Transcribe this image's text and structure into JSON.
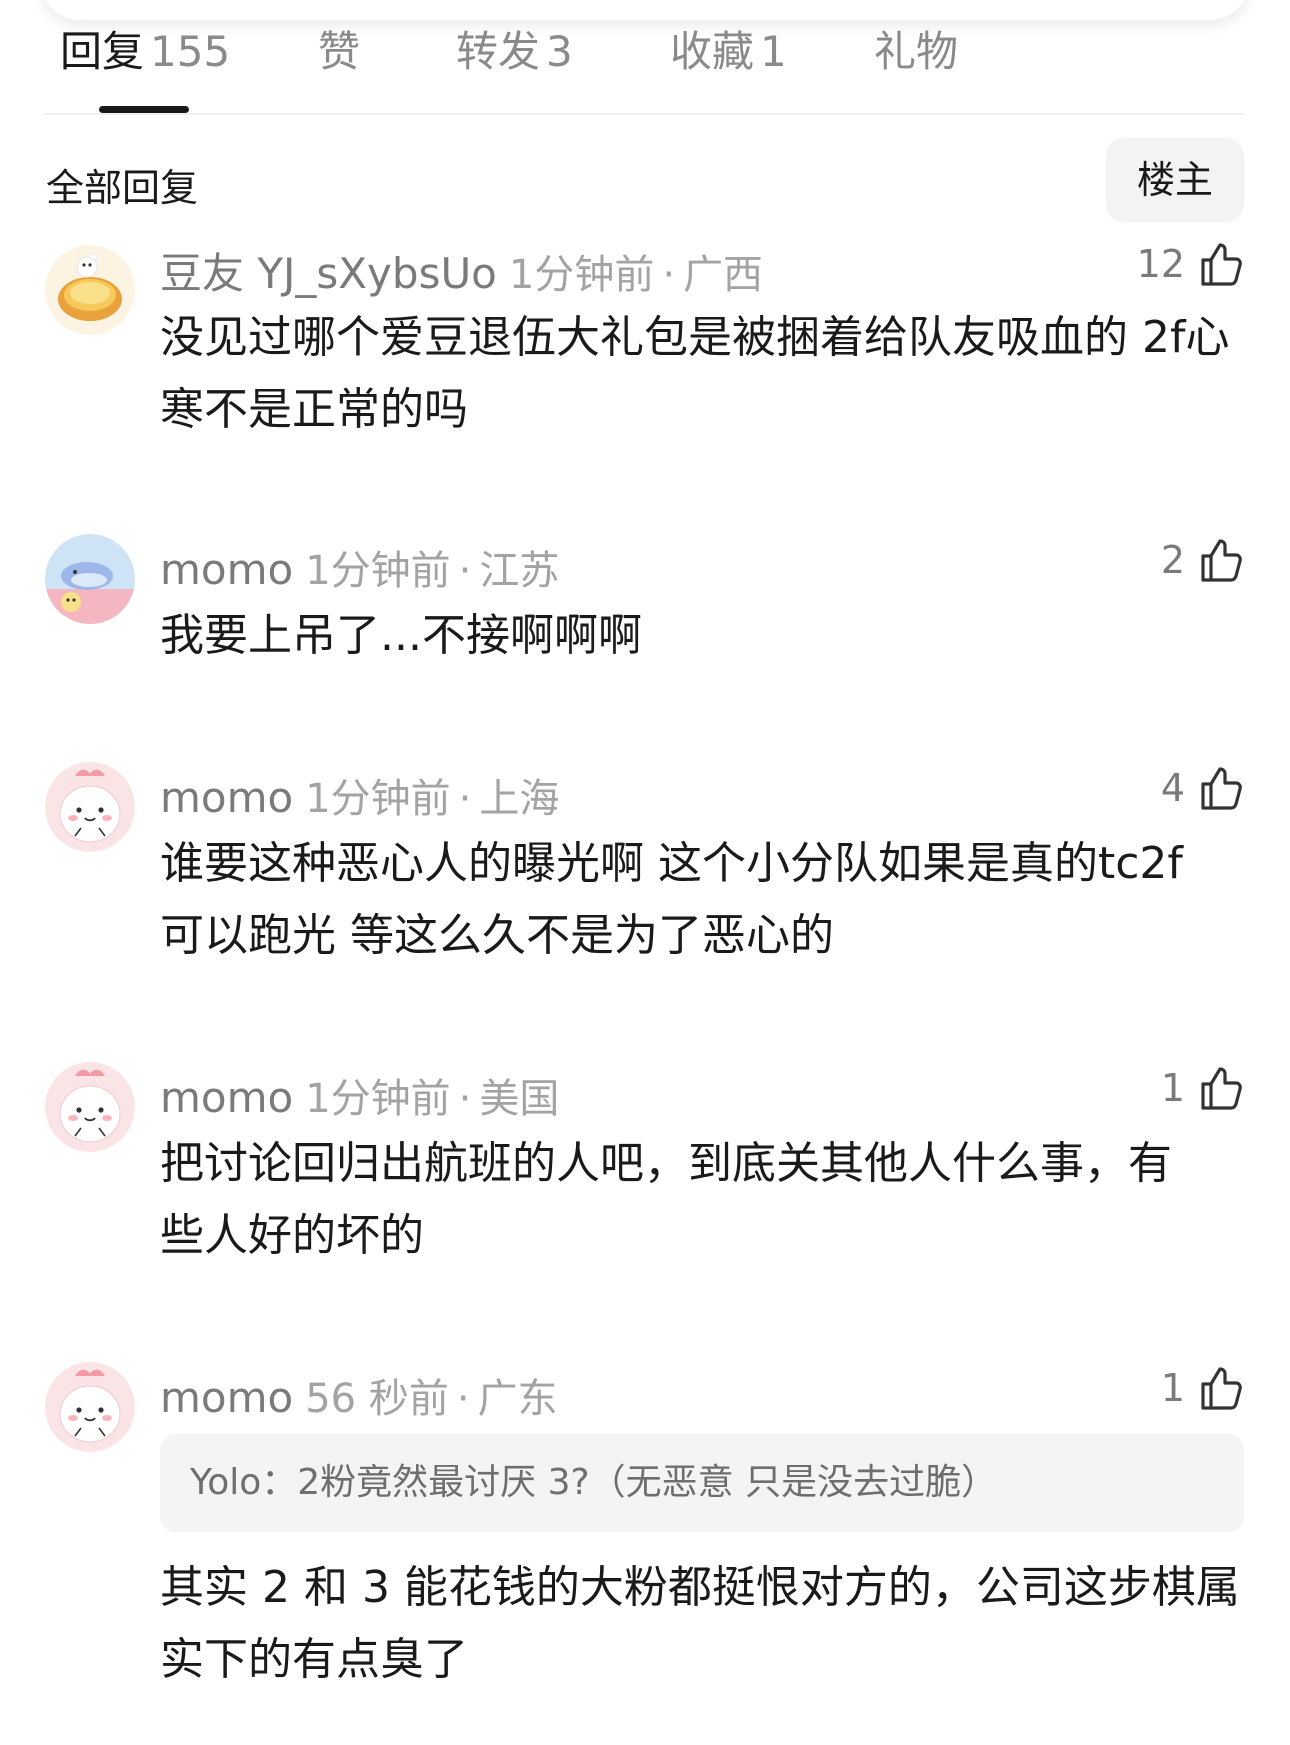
{
  "tabs": [
    {
      "label": "回复",
      "count": "155"
    },
    {
      "label": "赞",
      "count": ""
    },
    {
      "label": "转发",
      "count": "3"
    },
    {
      "label": "收藏",
      "count": "1"
    },
    {
      "label": "礼物",
      "count": ""
    }
  ],
  "section_title": "全部回复",
  "filter_button": "楼主",
  "comments": [
    {
      "username": "豆友 YJ_sXybsUo",
      "time": "1分钟前",
      "separator": "·",
      "location": "广西",
      "likes": "12",
      "text": "没见过哪个爱豆退伍大礼包是被捆着给队友吸血的 2f心寒不是正常的吗"
    },
    {
      "username": "momo",
      "time": "1分钟前",
      "separator": "·",
      "location": "江苏",
      "likes": "2",
      "text": "我要上吊了...不接啊啊啊"
    },
    {
      "username": "momo",
      "time": "1分钟前",
      "separator": "·",
      "location": "上海",
      "likes": "4",
      "text": "谁要这种恶心人的曝光啊 这个小分队如果是真的tc2f可以跑光 等这么久不是为了恶心的"
    },
    {
      "username": "momo",
      "time": "1分钟前",
      "separator": "·",
      "location": "美国",
      "likes": "1",
      "text": "把讨论回归出航班的人吧，到底关其他人什么事，有些人好的坏的"
    },
    {
      "username": "momo",
      "time": "56 秒前",
      "separator": "·",
      "location": "广东",
      "likes": "1",
      "quote": "Yolo：2粉竟然最讨厌 3?（无恶意 只是没去过脆）",
      "text": "其实 2 和 3 能花钱的大粉都挺恨对方的，公司这步棋属实下的有点臭了"
    }
  ],
  "colors": {
    "text_primary": "#1a1a1a",
    "text_secondary": "#7a7a7a",
    "text_muted": "#a3a3a3",
    "quote_bg": "#f4f4f4",
    "button_bg": "#f3f3f3",
    "avatar_pink": "#fbe4e6"
  },
  "icons": [
    "thumbs-up-icon"
  ]
}
